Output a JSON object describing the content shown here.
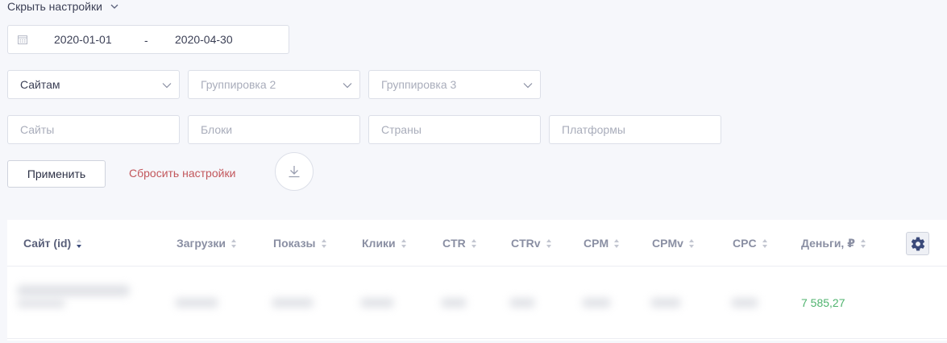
{
  "settings_toggle": {
    "label": "Скрыть настройки",
    "icon": "chevron-down-icon"
  },
  "date_range": {
    "from": "2020-01-01",
    "separator": "-",
    "to": "2020-04-30",
    "icon": "calendar-icon"
  },
  "groupings": [
    {
      "label": "Сайтам",
      "muted": false
    },
    {
      "label": "Группировка 2",
      "muted": true
    },
    {
      "label": "Группировка 3",
      "muted": true
    }
  ],
  "filters": {
    "sites": "Сайты",
    "blocks": "Блоки",
    "countries": "Страны",
    "platforms": "Платформы"
  },
  "actions": {
    "apply": "Применить",
    "reset": "Сбросить настройки",
    "download_icon": "download-icon"
  },
  "table": {
    "columns": [
      {
        "label": "Сайт (id)",
        "active_sort": true
      },
      {
        "label": "Загрузки"
      },
      {
        "label": "Показы"
      },
      {
        "label": "Клики"
      },
      {
        "label": "CTR"
      },
      {
        "label": "CTRv"
      },
      {
        "label": "CPM"
      },
      {
        "label": "CPMv"
      },
      {
        "label": "CPC"
      },
      {
        "label": "Деньги, ₽"
      }
    ],
    "settings_icon": "gear-icon",
    "rows": [
      {
        "money": "7 585,27"
      }
    ]
  },
  "colors": {
    "background": "#f6f7fb",
    "reset_link": "#c2575c",
    "money_positive": "#4fb36e",
    "settings_icon": "#3b4a7a"
  }
}
